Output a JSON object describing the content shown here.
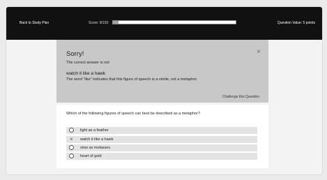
{
  "header": {
    "back_label": "Back to Study Plan",
    "score_label": "Score: 8/150",
    "progress_fraction": 0.045,
    "question_value": "Question Value: 5 points"
  },
  "feedback": {
    "title": "Sorry!",
    "close_icon": "×",
    "intro": "The correct answer is not",
    "selected_answer": "watch it like a hawk",
    "explanation": "The word \"like\" indicates that this figure of speech is a simile, not a metaphor.",
    "challenge_label": "Challenge this Question"
  },
  "question": {
    "text": "Which of the following figures of speech can best be described as a metaphor?",
    "options": [
      {
        "label": "light as a feather",
        "state": "unselected"
      },
      {
        "label": "watch it like a hawk",
        "state": "incorrect",
        "marker_glyph": "×"
      },
      {
        "label": "slow as molasses",
        "state": "unselected"
      },
      {
        "label": "heart of gold",
        "state": "unselected"
      }
    ]
  }
}
